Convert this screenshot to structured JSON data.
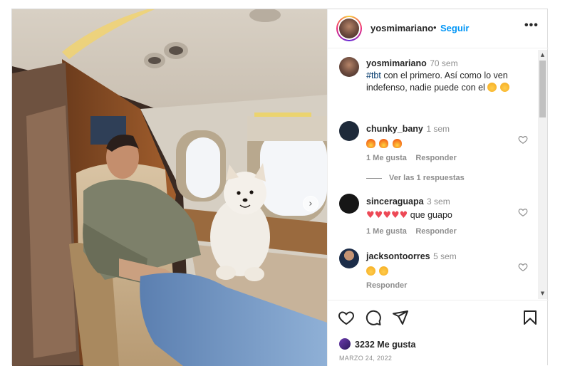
{
  "post": {
    "username": "yosmimariano",
    "dot": "•",
    "follow_label": "Seguir",
    "more_label": "•••",
    "next_label": "›"
  },
  "caption": {
    "username": "yosmimariano",
    "time": "70 sem",
    "hashtag": "#tbt",
    "text_1": " con el primero. Así como lo ven",
    "text_2": "indefenso, nadie puede con el "
  },
  "comments": [
    {
      "username": "chunky_bany",
      "time": "1 sem",
      "text": "",
      "likes_label": "1 Me gusta",
      "reply_label": "Responder",
      "replies_label": "Ver las 1 respuestas",
      "emojis": [
        "fire",
        "fire",
        "fire"
      ]
    },
    {
      "username": "sinceraguapa",
      "time": "3 sem",
      "text": " que guapo",
      "likes_label": "1 Me gusta",
      "reply_label": "Responder",
      "emojis": [
        "red-heart",
        "red-heart",
        "red-heart",
        "red-heart",
        "red-heart"
      ]
    },
    {
      "username": "jacksontoorres",
      "time": "5 sem",
      "text": "",
      "reply_label": "Responder",
      "emojis": [
        "heart-eyes",
        "heart-eyes"
      ]
    }
  ],
  "footer": {
    "likes": "3232 Me gusta",
    "date": "MARZO 24, 2022"
  },
  "colors": {
    "link": "#0095f6",
    "muted": "#8e8e8e",
    "text": "#262626",
    "heart_red": "#ed4956"
  },
  "icons": [
    "more-icon",
    "heart-icon",
    "comment-icon",
    "share-icon",
    "bookmark-icon",
    "next-arrow-icon",
    "scroll-up-icon",
    "scroll-down-icon"
  ]
}
